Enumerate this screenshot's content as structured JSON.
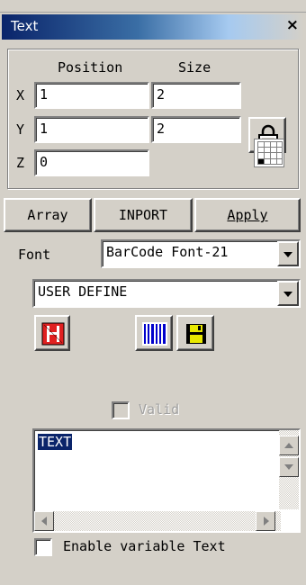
{
  "panel": {
    "title": "Text",
    "close_glyph": "×"
  },
  "geometry": {
    "position_label": "Position",
    "size_label": "Size",
    "x_label": "X",
    "y_label": "Y",
    "z_label": "Z",
    "pos_x": "1",
    "pos_y": "1",
    "pos_z": "0",
    "size_x": "2",
    "size_y": "2"
  },
  "toolbar": {
    "array_label": "Array",
    "inport_label": "INPORT",
    "apply_label": "Apply"
  },
  "font": {
    "label": "Font",
    "selected": "BarCode Font-21"
  },
  "mode": {
    "selected": "USER DEFINE"
  },
  "icons": [
    "hatch-red-icon",
    "barcode-icon",
    "save-icon",
    "lock-icon",
    "grid-icon"
  ],
  "valid": {
    "label": "Valid",
    "checked": false
  },
  "text_area": {
    "value": "TEXT"
  },
  "variable_text": {
    "label": "Enable variable Text",
    "checked": false
  },
  "colors": {
    "title_bar": "#0a246a",
    "face": "#d4d0c8",
    "selection": "#0a246a"
  }
}
